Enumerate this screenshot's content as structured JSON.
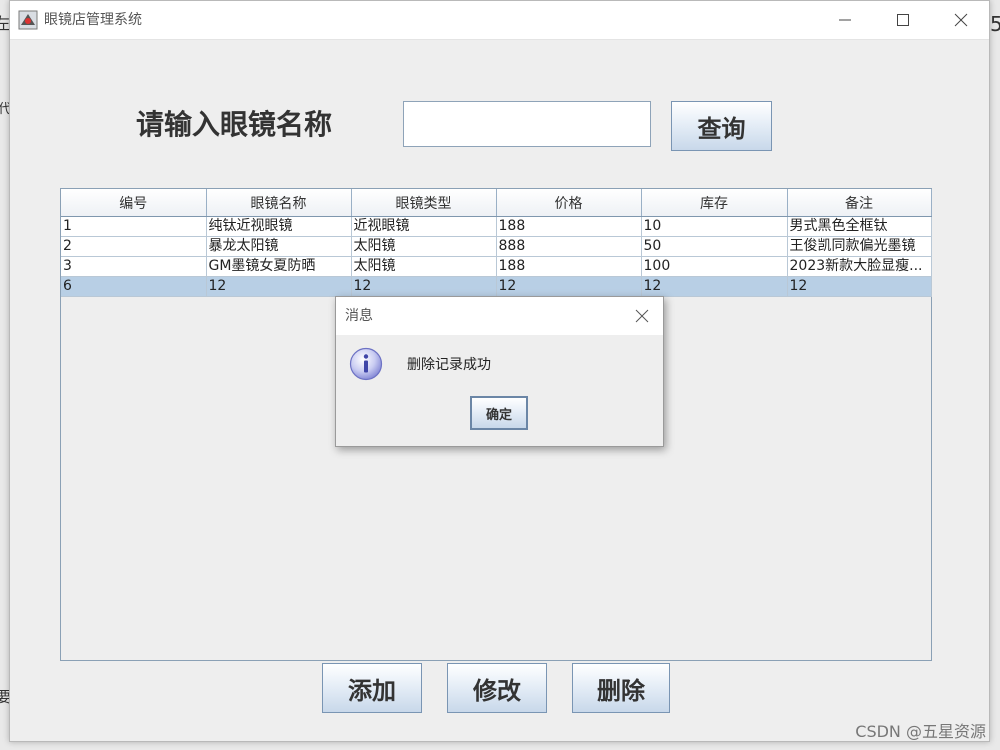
{
  "window": {
    "title": "眼镜店管理系统"
  },
  "search": {
    "label": "请输入眼镜名称",
    "value": "",
    "button_label": "查询"
  },
  "table": {
    "columns": [
      "编号",
      "眼镜名称",
      "眼镜类型",
      "价格",
      "库存",
      "备注"
    ],
    "rows": [
      [
        "1",
        "纯钛近视眼镜",
        "近视眼镜",
        "188",
        "10",
        "男式黑色全框钛"
      ],
      [
        "2",
        "暴龙太阳镜",
        "太阳镜",
        "888",
        "50",
        "王俊凯同款偏光墨镜"
      ],
      [
        "3",
        "GM墨镜女夏防晒",
        "太阳镜",
        "188",
        "100",
        "2023新款大脸显瘦..."
      ],
      [
        "6",
        "12",
        "12",
        "12",
        "12",
        "12"
      ]
    ],
    "selected_row": 3
  },
  "actions": {
    "add_label": "添加",
    "edit_label": "修改",
    "delete_label": "删除"
  },
  "dialog": {
    "title": "消息",
    "message": "删除记录成功",
    "ok_label": "确定"
  },
  "background": {
    "frag_top": "左",
    "frag_right": "5",
    "frag_mid": "代",
    "frag_bottom": "要"
  },
  "watermark": "CSDN @五星资源",
  "colors": {
    "selected_row": "#b8cfe5",
    "button_border": "#7a95b3",
    "info_icon": "#8a8ed8"
  }
}
